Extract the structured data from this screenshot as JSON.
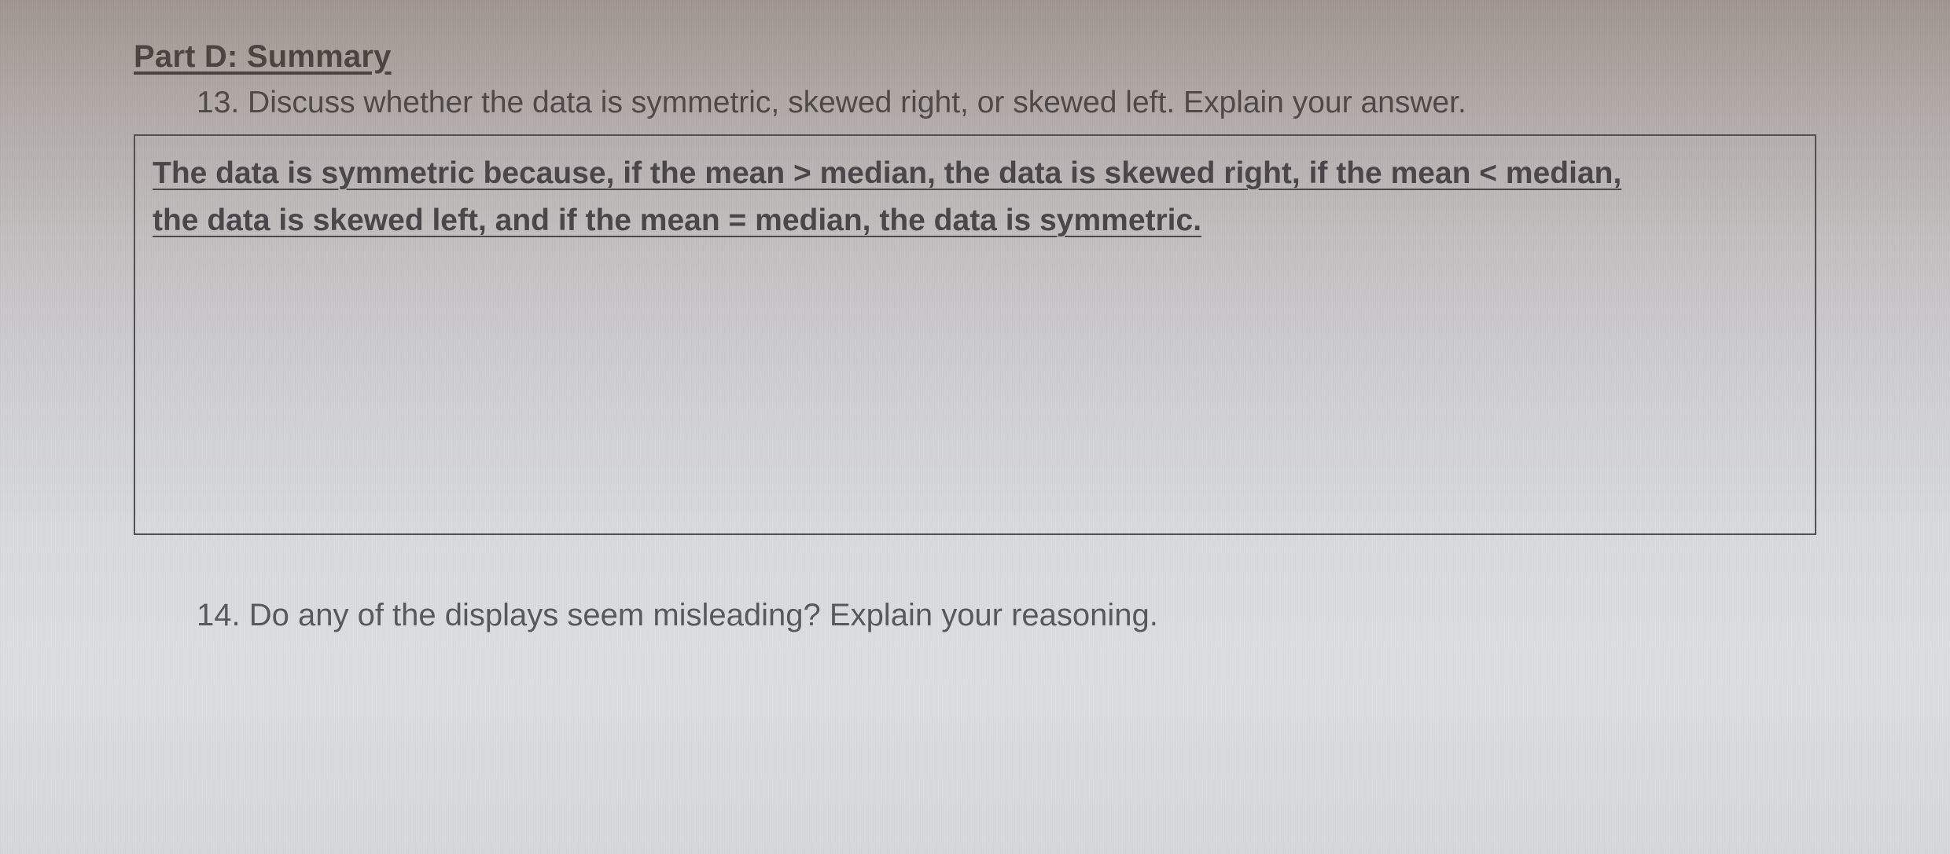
{
  "part": {
    "label": "Part D:  Summary"
  },
  "q13": {
    "prompt": "13. Discuss whether the data is symmetric, skewed right, or skewed left. Explain your answer.",
    "answer_line1": "The data is symmetric because, if the mean > median, the data is skewed right, if the mean < median,",
    "answer_line2_a": "the data is skewed left, and if the mean = median, the data is ",
    "answer_line2_b": "symmetric."
  },
  "q14": {
    "prompt": "14. Do any of the displays seem misleading? Explain your reasoning."
  }
}
